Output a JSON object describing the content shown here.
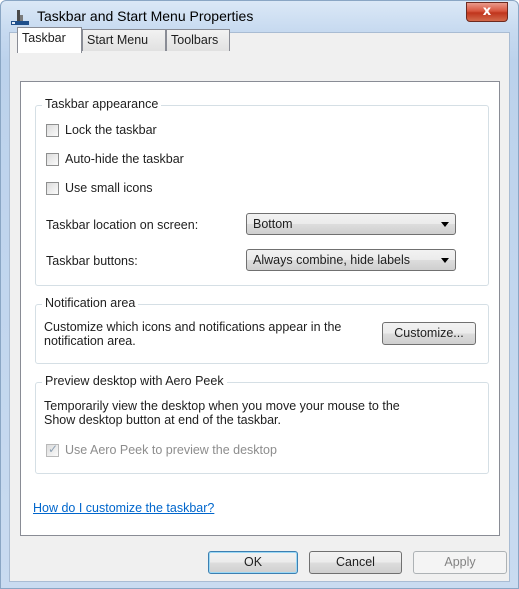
{
  "window": {
    "title": "Taskbar and Start Menu Properties",
    "close_symbol": "x",
    "icon": "taskbar-app-icon"
  },
  "tabs": [
    {
      "label": "Taskbar",
      "active": true
    },
    {
      "label": "Start Menu",
      "active": false
    },
    {
      "label": "Toolbars",
      "active": false
    }
  ],
  "appearance": {
    "legend": "Taskbar appearance",
    "lock_label": "Lock the taskbar",
    "lock_checked": false,
    "autohide_label": "Auto-hide the taskbar",
    "autohide_checked": false,
    "small_icons_label": "Use small icons",
    "small_icons_checked": false,
    "location_label": "Taskbar location on screen:",
    "location_value": "Bottom",
    "buttons_label": "Taskbar buttons:",
    "buttons_value": "Always combine, hide labels"
  },
  "notification": {
    "legend": "Notification area",
    "desc_line1": "Customize which icons and notifications appear in the",
    "desc_line2": "notification area.",
    "customize_label": "Customize..."
  },
  "aero_peek": {
    "legend": "Preview desktop with Aero Peek",
    "desc_line1": "Temporarily view the desktop when you move your mouse to the",
    "desc_line2": "Show desktop button at end of the taskbar.",
    "check_label": "Use Aero Peek to preview the desktop",
    "checked": true,
    "enabled": false
  },
  "help_link": "How do I customize the taskbar?",
  "footer": {
    "ok": "OK",
    "cancel": "Cancel",
    "apply": "Apply"
  },
  "colors": {
    "link": "#0066cc",
    "close_button": "#c7432a",
    "default_button_border": "#3c7fb1"
  }
}
